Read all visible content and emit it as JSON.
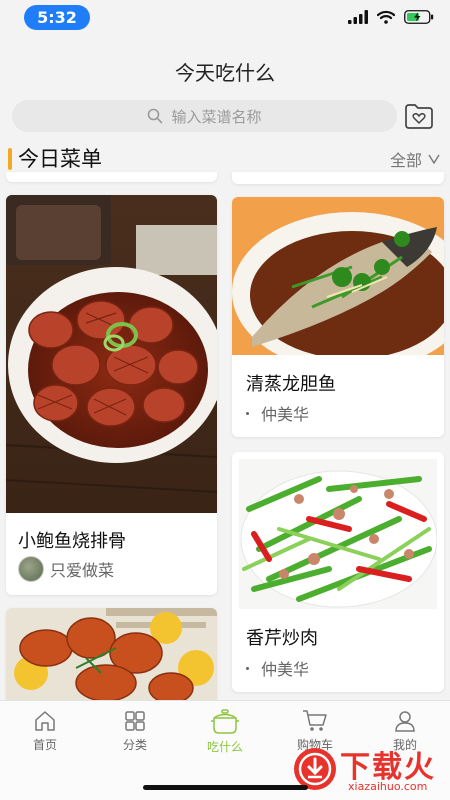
{
  "status_bar": {
    "time": "5:32"
  },
  "header": {
    "title": "今天吃什么"
  },
  "search": {
    "placeholder": "输入菜谱名称"
  },
  "section": {
    "title": "今日菜单",
    "filter_label": "全部"
  },
  "cards": [
    {
      "title": "小鲍鱼烧排骨",
      "author": "只爱做菜"
    },
    {
      "title": "清蒸龙胆鱼",
      "author": "仲美华"
    },
    {
      "title": "香芹炒肉",
      "author": "仲美华"
    }
  ],
  "tabs": [
    {
      "label": "首页",
      "icon": "home-icon"
    },
    {
      "label": "分类",
      "icon": "grid-icon"
    },
    {
      "label": "吃什么",
      "icon": "pot-icon"
    },
    {
      "label": "购物车",
      "icon": "cart-icon"
    },
    {
      "label": "我的",
      "icon": "user-icon"
    }
  ],
  "colors": {
    "accent": "#8cc63f",
    "section_bar": "#f5a623",
    "time_pill": "#1f7ef7"
  },
  "watermark": {
    "main": "下载火",
    "sub": "xiazaihuo.com"
  }
}
